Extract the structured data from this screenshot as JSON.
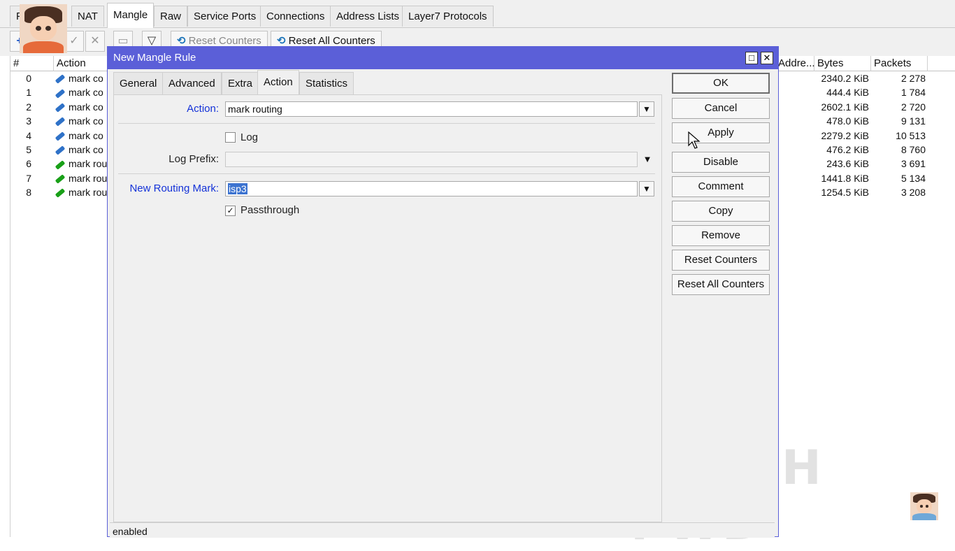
{
  "top_tabs": [
    {
      "label": "F",
      "active": false
    },
    {
      "label": "NAT",
      "active": false
    },
    {
      "label": "Mangle",
      "active": true
    },
    {
      "label": "Raw",
      "active": false
    },
    {
      "label": "Service Ports",
      "active": false
    },
    {
      "label": "Connections",
      "active": false
    },
    {
      "label": "Address Lists",
      "active": false
    },
    {
      "label": "Layer7 Protocols",
      "active": false
    }
  ],
  "toolbar": {
    "reset_counters": "Reset Counters",
    "reset_all_counters": "Reset All Counters"
  },
  "table": {
    "headers": {
      "num": "#",
      "action": "Action",
      "address": "Addre...",
      "bytes": "Bytes",
      "packets": "Packets"
    },
    "rows": [
      {
        "num": "0",
        "action": "mark co",
        "icon": "blue-pen-icon",
        "bytes": "2340.2 KiB",
        "packets": "2 278"
      },
      {
        "num": "1",
        "action": "mark co",
        "icon": "blue-pen-icon",
        "bytes": "444.4 KiB",
        "packets": "1 784"
      },
      {
        "num": "2",
        "action": "mark co",
        "icon": "blue-pen-icon",
        "bytes": "2602.1 KiB",
        "packets": "2 720"
      },
      {
        "num": "3",
        "action": "mark co",
        "icon": "blue-pen-icon",
        "bytes": "478.0 KiB",
        "packets": "9 131"
      },
      {
        "num": "4",
        "action": "mark co",
        "icon": "blue-pen-icon",
        "bytes": "2279.2 KiB",
        "packets": "10 513"
      },
      {
        "num": "5",
        "action": "mark co",
        "icon": "blue-pen-icon",
        "bytes": "476.2 KiB",
        "packets": "8 760"
      },
      {
        "num": "6",
        "action": "mark rou",
        "icon": "green-pen-icon",
        "bytes": "243.6 KiB",
        "packets": "3 691"
      },
      {
        "num": "7",
        "action": "mark rou",
        "icon": "green-pen-icon",
        "bytes": "1441.8 KiB",
        "packets": "5 134"
      },
      {
        "num": "8",
        "action": "mark rou",
        "icon": "green-pen-icon",
        "bytes": "1254.5 KiB",
        "packets": "3 208"
      }
    ]
  },
  "dialog": {
    "title": "New Mangle Rule",
    "tabs": [
      {
        "label": "General",
        "active": false
      },
      {
        "label": "Advanced",
        "active": false
      },
      {
        "label": "Extra",
        "active": false
      },
      {
        "label": "Action",
        "active": true
      },
      {
        "label": "Statistics",
        "active": false
      }
    ],
    "action_label": "Action:",
    "action_value": "mark routing",
    "log_label": "Log",
    "log_checked": false,
    "log_prefix_label": "Log Prefix:",
    "log_prefix_value": "",
    "routing_mark_label": "New Routing Mark:",
    "routing_mark_value": "isp3",
    "passthrough_label": "Passthrough",
    "passthrough_checked": true,
    "buttons": [
      "OK",
      "Cancel",
      "Apply",
      "Disable",
      "Comment",
      "Copy",
      "Remove",
      "Reset Counters",
      "Reset All Counters"
    ],
    "status": "enabled"
  },
  "watermark": "TEGUH PWD",
  "colors": {
    "titlebar": "#5b5fd8",
    "field_label_blue": "#1432d8",
    "selection": "#3c73d0"
  }
}
